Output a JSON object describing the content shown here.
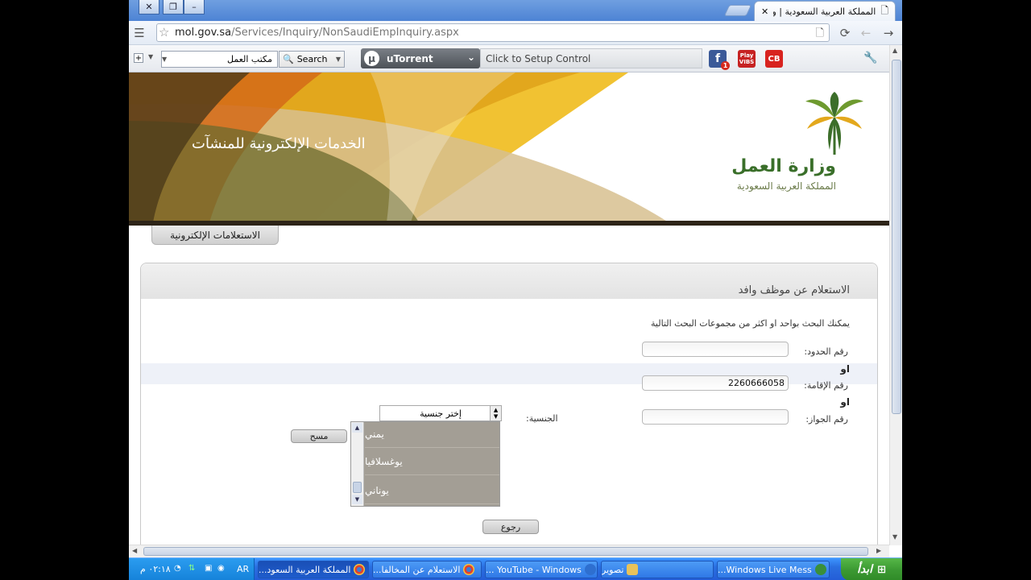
{
  "browser": {
    "tab_title": "المملكة العربية السعودية | وزار",
    "url_host": "mol.gov.sa",
    "url_path": "/Services/Inquiry/NonSaudiEmpInquiry.aspx"
  },
  "toolbar": {
    "search_box_value": "مكتب العمل",
    "search_button": "Search",
    "utorrent_label": "uTorrent",
    "setup_control": "Click to Setup Control",
    "badge_count": "1",
    "playvibs_label": "Play VIBS",
    "cb_label": "CB"
  },
  "banner": {
    "portal_title": "الخدمات الإلكترونية للمنشآت",
    "ministry_name": "وزارة العمل",
    "ministry_sub": "المملكة العربية السعودية"
  },
  "nav": {
    "tab_inquiries": "الاستعلامات الإلكترونية"
  },
  "form": {
    "title": "الاستعلام عن موظف وافد",
    "intro": "يمكنك البحث بواحد او اكثر من مجموعات البحث التالية",
    "border_number_label": "رقم الحدود:",
    "border_number_value": "",
    "or_1": "او",
    "iqama_label": "رقم الإقامة:",
    "iqama_value": "2260666058",
    "or_2": "او",
    "passport_label": "رقم الجواز:",
    "passport_value": "",
    "nationality_label": "الجنسية:",
    "nationality_placeholder": "إختر جنسية",
    "nationality_options": [
      "يمني",
      "يوغسلافيا",
      "يوناني"
    ],
    "clear_button": "مسح",
    "back_button": "رجوع"
  },
  "taskbar": {
    "start": "ابدأ",
    "clock": "٠٢:١٨ م",
    "lang": "AR",
    "tasks": [
      {
        "label": "Windows Live Mess...",
        "color": "#3a8f3a"
      },
      {
        "label": "تصوير",
        "color": "#e8c25a"
      },
      {
        "label": "YouTube - Windows ...",
        "color": "#2e6fd0"
      },
      {
        "label": "الاستعلام عن المخالفا...",
        "color": "#d64a3a"
      },
      {
        "label": "المملكة العربية السعود...",
        "color": "#d64a3a"
      }
    ]
  },
  "colors": {
    "accent_gold": "#e9b21c",
    "accent_olive": "#8f7a36",
    "ministry_green": "#3a6f2a",
    "taskbar_blue": "#245dd7",
    "start_green": "#3c9a33"
  }
}
